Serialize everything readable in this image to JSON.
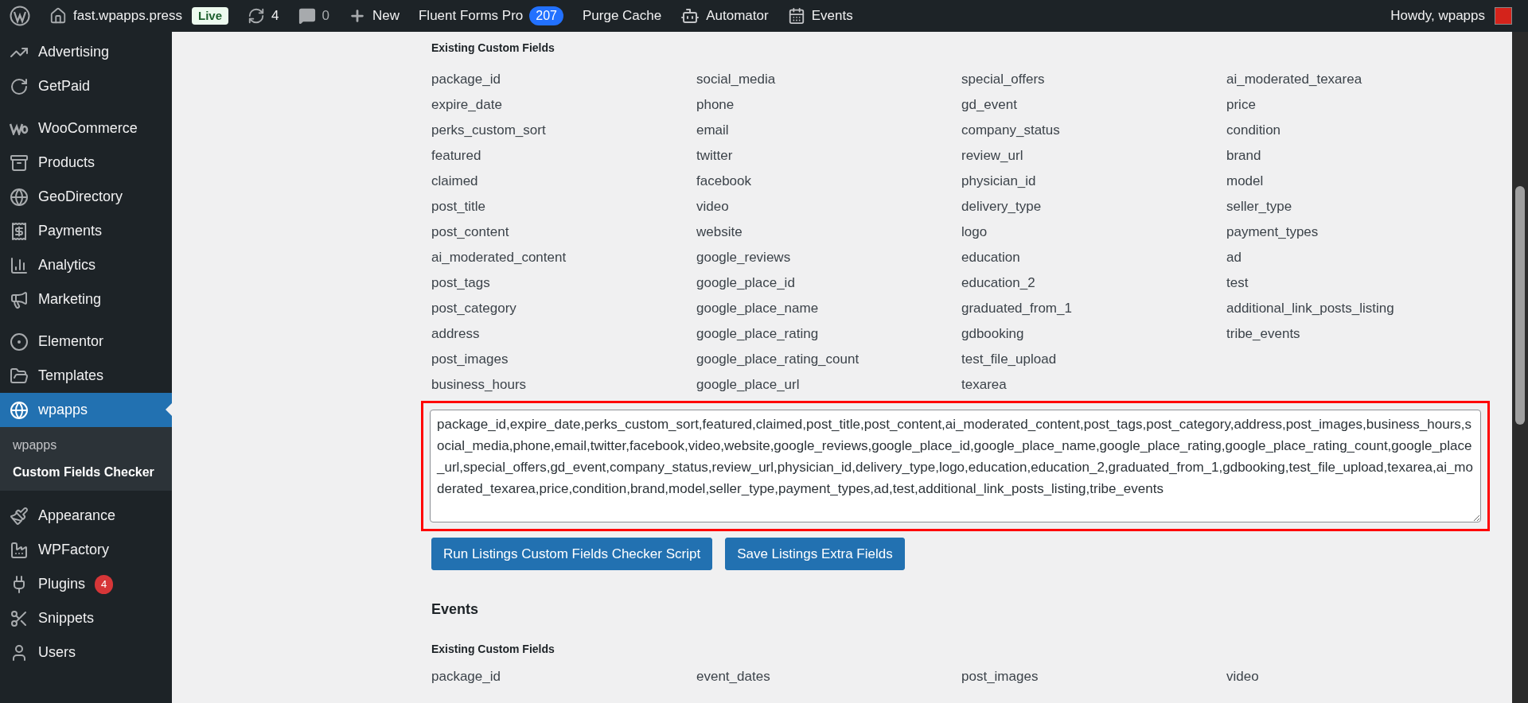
{
  "admin_bar": {
    "site": "fast.wpapps.press",
    "live_badge": "Live",
    "updates": "4",
    "comments": "0",
    "new": "New",
    "fluent_forms": {
      "label": "Fluent Forms Pro",
      "count": "207"
    },
    "purge_cache": "Purge Cache",
    "automator": "Automator",
    "events": "Events",
    "howdy": "Howdy, wpapps"
  },
  "sidebar": {
    "groups": [
      [
        {
          "label": "Advertising",
          "selected": false
        },
        {
          "label": "GetPaid",
          "selected": false
        }
      ],
      [
        {
          "label": "WooCommerce",
          "selected": false
        },
        {
          "label": "Products",
          "selected": false
        },
        {
          "label": "GeoDirectory",
          "selected": false
        },
        {
          "label": "Payments",
          "selected": false
        },
        {
          "label": "Analytics",
          "selected": false
        },
        {
          "label": "Marketing",
          "selected": false
        }
      ],
      [
        {
          "label": "Elementor",
          "selected": false
        },
        {
          "label": "Templates",
          "selected": false
        },
        {
          "label": "wpapps",
          "selected": true,
          "children": [
            {
              "label": "wpapps",
              "selected": false
            },
            {
              "label": "Custom Fields Checker",
              "selected": true
            }
          ]
        }
      ],
      [
        {
          "label": "Appearance",
          "selected": false
        },
        {
          "label": "WPFactory",
          "selected": false
        },
        {
          "label": "Plugins",
          "selected": false,
          "badge": "4"
        },
        {
          "label": "Snippets",
          "selected": false
        },
        {
          "label": "Users",
          "selected": false
        }
      ]
    ]
  },
  "listings": {
    "heading": "Existing Custom Fields",
    "columns": [
      [
        "package_id",
        "expire_date",
        "perks_custom_sort",
        "featured",
        "claimed",
        "post_title",
        "post_content",
        "ai_moderated_content",
        "post_tags",
        "post_category",
        "address",
        "post_images",
        "business_hours"
      ],
      [
        "social_media",
        "phone",
        "email",
        "twitter",
        "facebook",
        "video",
        "website",
        "google_reviews",
        "google_place_id",
        "google_place_name",
        "google_place_rating",
        "google_place_rating_count",
        "google_place_url"
      ],
      [
        "special_offers",
        "gd_event",
        "company_status",
        "review_url",
        "physician_id",
        "delivery_type",
        "logo",
        "education",
        "education_2",
        "graduated_from_1",
        "gdbooking",
        "test_file_upload",
        "texarea"
      ],
      [
        "ai_moderated_texarea",
        "price",
        "condition",
        "brand",
        "model",
        "seller_type",
        "payment_types",
        "ad",
        "test",
        "additional_link_posts_listing",
        "tribe_events"
      ]
    ],
    "fields_value": "package_id,expire_date,perks_custom_sort,featured,claimed,post_title,post_content,ai_moderated_content,post_tags,post_category,address,post_images,business_hours,social_media,phone,email,twitter,facebook,video,website,google_reviews,google_place_id,google_place_name,google_place_rating,google_place_rating_count,google_place_url,special_offers,gd_event,company_status,review_url,physician_id,delivery_type,logo,education,education_2,graduated_from_1,gdbooking,test_file_upload,texarea,ai_moderated_texarea,price,condition,brand,model,seller_type,payment_types,ad,test,additional_link_posts_listing,tribe_events",
    "buttons": [
      "Run Listings Custom Fields Checker Script",
      "Save Listings Extra Fields"
    ]
  },
  "events": {
    "title": "Events",
    "heading": "Existing Custom Fields",
    "columns": [
      [
        "package_id"
      ],
      [
        "event_dates"
      ],
      [
        "post_images"
      ],
      [
        "video"
      ]
    ]
  }
}
